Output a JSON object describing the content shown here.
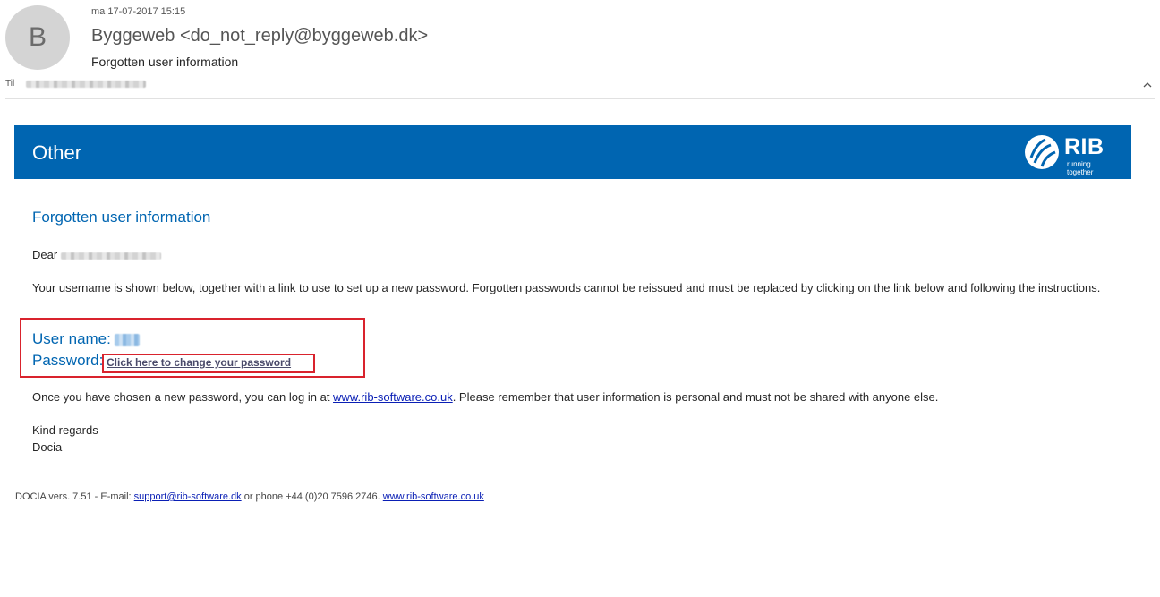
{
  "header": {
    "avatar_initial": "B",
    "timestamp": "ma 17-07-2017 15:15",
    "sender": "Byggeweb <do_not_reply@byggeweb.dk>",
    "subject": "Forgotten user information",
    "to_label": "Til"
  },
  "banner": {
    "title": "Other",
    "logo_text": "RIB",
    "logo_tagline": "running together",
    "color": "#0065b1"
  },
  "body": {
    "heading": "Forgotten user information",
    "dear": "Dear",
    "intro": "Your username is shown below, together with a link to use to set up a new password. Forgotten passwords cannot be reissued and must be replaced by clicking on the link below and following the instructions.",
    "username_label": "User name:",
    "password_label": "Password:",
    "change_password_link": "Click here to change your password",
    "once_before": "Once you have chosen a new password, you can log in at ",
    "once_link": "www.rib-software.co.uk",
    "once_after": ". Please remember that user information is personal and must not be shared with anyone else.",
    "regards": "Kind regards",
    "signer": "Docia"
  },
  "footer": {
    "prefix": "DOCIA vers. 7.51 - E-mail: ",
    "email_link": "support@rib-software.dk",
    "middle": " or phone +44 (0)20 7596 2746. ",
    "site_link": "www.rib-software.co.uk"
  },
  "icons": {
    "collapse": "chevron-up-icon",
    "logo": "rib-logo-icon"
  },
  "colors": {
    "accent": "#0065b1",
    "highlight": "#d9232d",
    "link": "#0a1fb5"
  }
}
